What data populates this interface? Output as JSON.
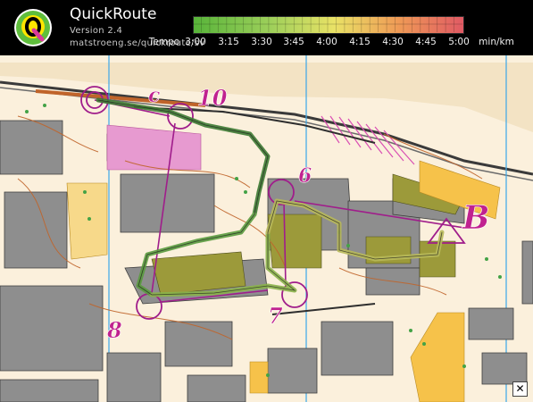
{
  "app": {
    "title": "QuickRoute",
    "version": "Version 2.4",
    "url": "matstroeng.se/quickroute/sv"
  },
  "legend": {
    "caption": "Tempo",
    "unit": "min/km",
    "ticks": [
      "3:00",
      "3:15",
      "3:30",
      "3:45",
      "4:00",
      "4:15",
      "4:30",
      "4:45",
      "5:00"
    ],
    "colors": [
      "#58b43a",
      "#9ccf5a",
      "#e9e266",
      "#ef9a56",
      "#e05a64"
    ]
  },
  "map": {
    "control_labels": [
      "c",
      "10",
      "6",
      "B",
      "8",
      "7"
    ],
    "close_icon": "close-icon"
  }
}
